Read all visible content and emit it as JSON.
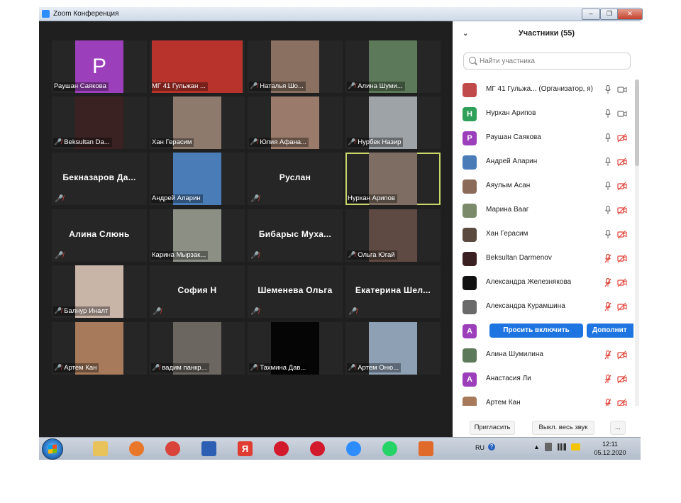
{
  "window": {
    "title": "Zoom Конференция",
    "controls": [
      "–",
      "❐",
      "✕"
    ]
  },
  "tiles": [
    {
      "kind": "avatar",
      "letter": "P",
      "label": "Раушан Саякова",
      "muted": false
    },
    {
      "kind": "video",
      "wide": true,
      "label": "МГ 41 Гульжан ...",
      "muted": false,
      "tone": "#b8332c"
    },
    {
      "kind": "video",
      "label": "Наталья Шо...",
      "muted": true,
      "tone": "#8a7060"
    },
    {
      "kind": "video",
      "label": "Алина Шуми...",
      "muted": true,
      "tone": "#5c7a5a"
    },
    {
      "kind": "video",
      "label": "Beksultan Da...",
      "muted": true,
      "tone": "#3a2222"
    },
    {
      "kind": "video",
      "label": "Хан Герасим",
      "muted": false,
      "tone": "#8d7a6d"
    },
    {
      "kind": "video",
      "label": "Юлия Афана...",
      "muted": true,
      "tone": "#9a7a6a"
    },
    {
      "kind": "video",
      "label": "Нурбек Назир",
      "muted": true,
      "tone": "#9ea3a8"
    },
    {
      "kind": "name",
      "name": "Бекназаров Да...",
      "muted": true
    },
    {
      "kind": "video",
      "label": "Андрей Аларин",
      "muted": false,
      "tone": "#4a7db8"
    },
    {
      "kind": "name",
      "name": "Руслан",
      "muted": true
    },
    {
      "kind": "video",
      "label": "Нурхан Арипов",
      "muted": false,
      "active": true,
      "tone": "#7d6d62"
    },
    {
      "kind": "name",
      "name": "Алина Слюнь",
      "muted": true
    },
    {
      "kind": "video",
      "label": "Карина Мырзак...",
      "muted": false,
      "tone": "#8b8f84"
    },
    {
      "kind": "name",
      "name": "Бибарыс Муха...",
      "muted": true
    },
    {
      "kind": "video",
      "label": "Ольга Югай",
      "muted": true,
      "tone": "#5e4a42"
    },
    {
      "kind": "video",
      "label": "Балнур Иналт",
      "muted": true,
      "tone": "#c9b4a8"
    },
    {
      "kind": "name",
      "name": "София Н",
      "muted": true
    },
    {
      "kind": "name",
      "name": "Шеменева Ольга",
      "muted": true
    },
    {
      "kind": "name",
      "name": "Екатерина Шел...",
      "muted": true
    },
    {
      "kind": "video",
      "label": "Артем Кан",
      "muted": true,
      "tone": "#a67a5a"
    },
    {
      "kind": "video",
      "label": "вадим панкр...",
      "muted": true,
      "tone": "#6b6660"
    },
    {
      "kind": "video",
      "label": "Тахмина Дав...",
      "muted": true,
      "tone": "#050505"
    },
    {
      "kind": "video",
      "label": "Артем Оню...",
      "muted": true,
      "tone": "#8ea0b4"
    }
  ],
  "participants": {
    "title": "Участники (55)",
    "search_placeholder": "Найти участника",
    "items": [
      {
        "name": "МГ 41 Гульжа... (Организатор, я)",
        "avatar": "photo",
        "color": "#c04a4a",
        "mic": "on",
        "cam": "on"
      },
      {
        "name": "Нурхан Арипов",
        "avatar": "letter",
        "letter": "H",
        "color": "#2ea05a",
        "mic": "on",
        "cam": "on"
      },
      {
        "name": "Раушан Саякова",
        "avatar": "letter",
        "letter": "P",
        "color": "#9c3fbb",
        "mic": "on",
        "cam": "off"
      },
      {
        "name": "Андрей Аларин",
        "avatar": "photo",
        "color": "#4a7db8",
        "mic": "on",
        "cam": "off"
      },
      {
        "name": "Аяулым Асан",
        "avatar": "photo",
        "color": "#8c6a5a",
        "mic": "on",
        "cam": "off"
      },
      {
        "name": "Марина Вааг",
        "avatar": "photo",
        "color": "#7a8a6a",
        "mic": "on",
        "cam": "off"
      },
      {
        "name": "Хан Герасим",
        "avatar": "photo",
        "color": "#5a4a40",
        "mic": "on",
        "cam": "off"
      },
      {
        "name": "Beksultan Darmenov",
        "avatar": "photo",
        "color": "#3a2020",
        "mic": "off",
        "cam": "off"
      },
      {
        "name": "Александра Железнякова",
        "avatar": "photo",
        "color": "#111111",
        "mic": "off",
        "cam": "off"
      },
      {
        "name": "Александра Курамшина",
        "avatar": "photo",
        "color": "#6a6a6a",
        "mic": "off",
        "cam": "off"
      },
      {
        "name": "",
        "avatar": "letter",
        "letter": "A",
        "color": "#9c3fbb",
        "action": "Просить включить",
        "more": "Дополнит"
      },
      {
        "name": "Алина Шумилина",
        "avatar": "photo",
        "color": "#5c7a5a",
        "mic": "off",
        "cam": "off"
      },
      {
        "name": "Анастасия Ли",
        "avatar": "letter",
        "letter": "A",
        "color": "#9c3fbb",
        "mic": "off",
        "cam": "off"
      },
      {
        "name": "Артем Кан",
        "avatar": "photo",
        "color": "#a67a5a",
        "mic": "off",
        "cam": "off"
      }
    ],
    "footer": {
      "invite": "Пригласить",
      "mute_all": "Выкл. весь звук",
      "more": "..."
    }
  },
  "taskbar": {
    "apps": [
      {
        "name": "explorer",
        "color": "#e8c25a"
      },
      {
        "name": "firefox",
        "color": "#e8772a"
      },
      {
        "name": "chrome",
        "color": "#d8443a"
      },
      {
        "name": "word",
        "color": "#2b5fb4"
      },
      {
        "name": "yandex",
        "glyph": "Я",
        "color": "#e03c31"
      },
      {
        "name": "opera",
        "color": "#d21a2c"
      },
      {
        "name": "opera2",
        "color": "#d21a2c"
      },
      {
        "name": "zoom",
        "color": "#2d8cff"
      },
      {
        "name": "whatsapp",
        "color": "#25d366"
      },
      {
        "name": "presentation",
        "color": "#e06a2a"
      }
    ],
    "lang": "RU",
    "time": "12:11",
    "date": "05.12.2020"
  }
}
